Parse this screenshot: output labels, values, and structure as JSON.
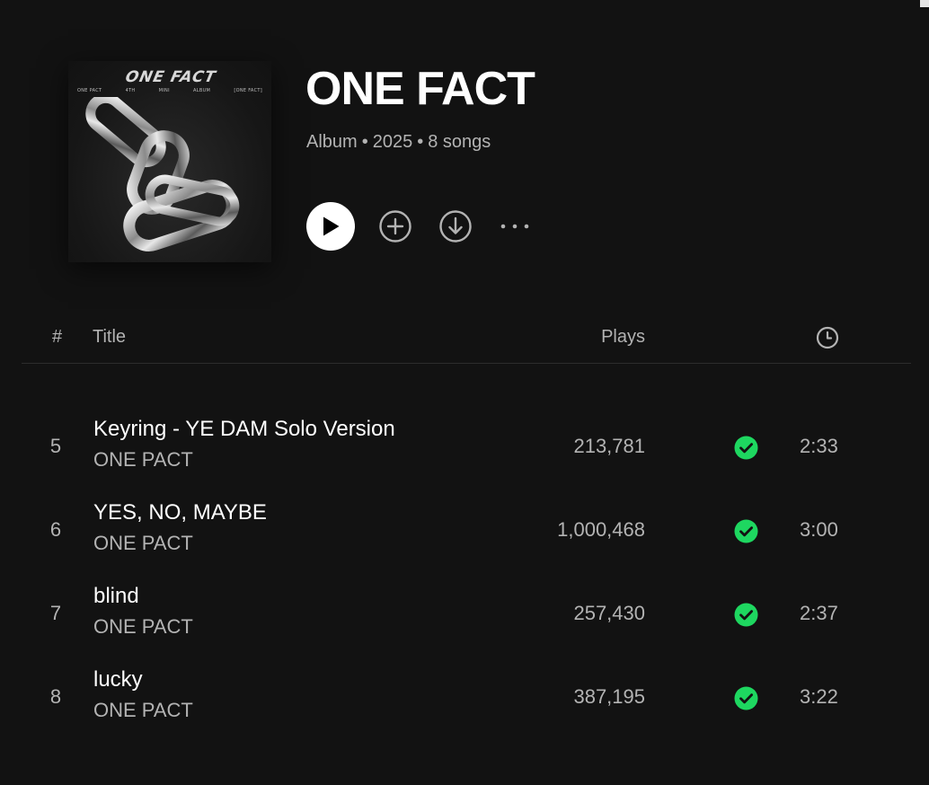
{
  "album": {
    "title": "ONE FACT",
    "type": "Album",
    "year": "2025",
    "song_count": "8 songs",
    "separator": "•",
    "cover": {
      "title_art": "ONE FACT",
      "sub_labels": [
        "ONE PACT",
        "4TH",
        "MINI",
        "ALBUM",
        "[ONE FACT]"
      ]
    }
  },
  "actions": {
    "play_icon": "play-icon",
    "add_icon": "add-circle-icon",
    "download_icon": "download-icon",
    "more_icon": "more-options-icon"
  },
  "table": {
    "headers": {
      "number": "#",
      "title": "Title",
      "plays": "Plays",
      "duration_icon": "clock-icon"
    },
    "rows": [
      {
        "number": "5",
        "title": "Keyring - YE DAM Solo Version",
        "artist": "ONE PACT",
        "plays": "213,781",
        "saved": true,
        "duration": "2:33"
      },
      {
        "number": "6",
        "title": "YES, NO, MAYBE",
        "artist": "ONE PACT",
        "plays": "1,000,468",
        "saved": true,
        "duration": "3:00"
      },
      {
        "number": "7",
        "title": "blind",
        "artist": "ONE PACT",
        "plays": "257,430",
        "saved": true,
        "duration": "2:37"
      },
      {
        "number": "8",
        "title": "lucky",
        "artist": "ONE PACT",
        "plays": "387,195",
        "saved": true,
        "duration": "3:22"
      }
    ]
  },
  "colors": {
    "background": "#121212",
    "text_primary": "#ffffff",
    "text_secondary": "#b3b3b3",
    "accent_green": "#1ed760"
  }
}
